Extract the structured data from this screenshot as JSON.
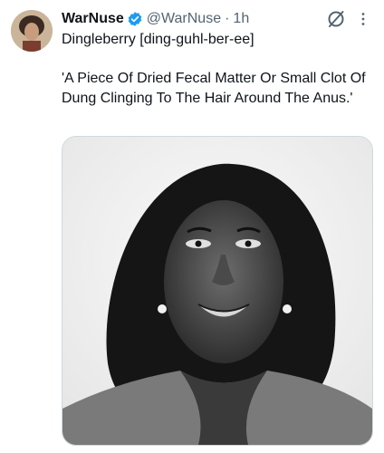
{
  "tweet": {
    "display_name": "WarNuse",
    "handle": "@WarNuse",
    "separator": "·",
    "time": "1h",
    "text_line1": "Dingleberry [ding-guhl-ber-ee]",
    "text_line2": "'A Piece Of Dried Fecal Matter Or Small Clot Of Dung Clinging To The Hair Around The Anus.'"
  },
  "icons": {
    "verified": "verified-badge-icon",
    "grok": "grok-icon",
    "more": "more-options-icon"
  },
  "colors": {
    "verified_blue": "#1d9bf0",
    "secondary_text": "#536471"
  }
}
